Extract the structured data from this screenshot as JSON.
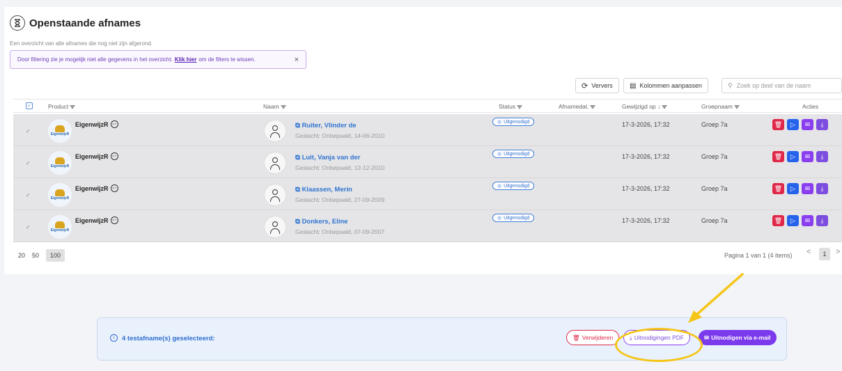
{
  "header": {
    "title": "Openstaande afnames",
    "subtitle": "Een overzicht van alle afnames die nog niet zijn afgerond.",
    "filter_note_before": "Door filtering zie je mogelijk niet alle gegevens in het overzicht.",
    "filter_note_link": "Klik hier",
    "filter_note_after": "om de filters te wissen.",
    "filter_close": "×"
  },
  "toolbar": {
    "refresh_label": "Ververs",
    "columns_label": "Kolommen aanpassen",
    "search_placeholder": "Zoek op deel van de naam"
  },
  "table": {
    "headers": {
      "product": "Product",
      "naam": "Naam",
      "status": "Status",
      "afnamedat": "Afnamedat.",
      "gewijzigd": "Gewijzigd op ↓",
      "groepnaam": "Groepnaam",
      "acties": "Acties"
    },
    "rows": [
      {
        "product": "EigenwijzR",
        "name": "Ruiter, Vlinder de",
        "sub": "Geslacht: Onbepaald, 14-06-2010",
        "status": "Uitgenodigd",
        "afnamedat": "",
        "gewijzigd": "17-3-2026, 17:32",
        "groep": "Groep 7a"
      },
      {
        "product": "EigenwijzR",
        "name": "Luit, Vanja van der",
        "sub": "Geslacht: Onbepaald, 12-12-2010",
        "status": "Uitgenodigd",
        "afnamedat": "",
        "gewijzigd": "17-3-2026, 17:32",
        "groep": "Groep 7a"
      },
      {
        "product": "EigenwijzR",
        "name": "Klaassen, Merin",
        "sub": "Geslacht: Onbepaald, 27-09-2009",
        "status": "Uitgenodigd",
        "afnamedat": "",
        "gewijzigd": "17-3-2026, 17:32",
        "groep": "Groep 7a"
      },
      {
        "product": "EigenwijzR",
        "name": "Donkers, Eline",
        "sub": "Geslacht: Onbepaald, 07-09-2007",
        "status": "Uitgenodigd",
        "afnamedat": "",
        "gewijzigd": "17-3-2026, 17:32",
        "groep": "Groep 7a"
      }
    ],
    "logo_text": "EigenwijzR"
  },
  "pagination": {
    "sizes": [
      "20",
      "50",
      "100"
    ],
    "info": "Pagina 1 van 1 (4 items)",
    "current": "1",
    "prev": "<",
    "next": ">"
  },
  "selection_bar": {
    "text": "4 testafname(s) geselecteerd:",
    "delete_label": "Verwijderen",
    "pdf_label": "Uitnodigingen PDF",
    "email_label": "Uitnodigen via e-mail"
  },
  "colors": {
    "accent_blue": "#2f6fd0",
    "delete_red": "#e0284a",
    "play_blue": "#2563eb",
    "mail_purple": "#8b3ef0",
    "download_purple": "#7c4dde",
    "highlight_yellow": "#f5c518"
  }
}
